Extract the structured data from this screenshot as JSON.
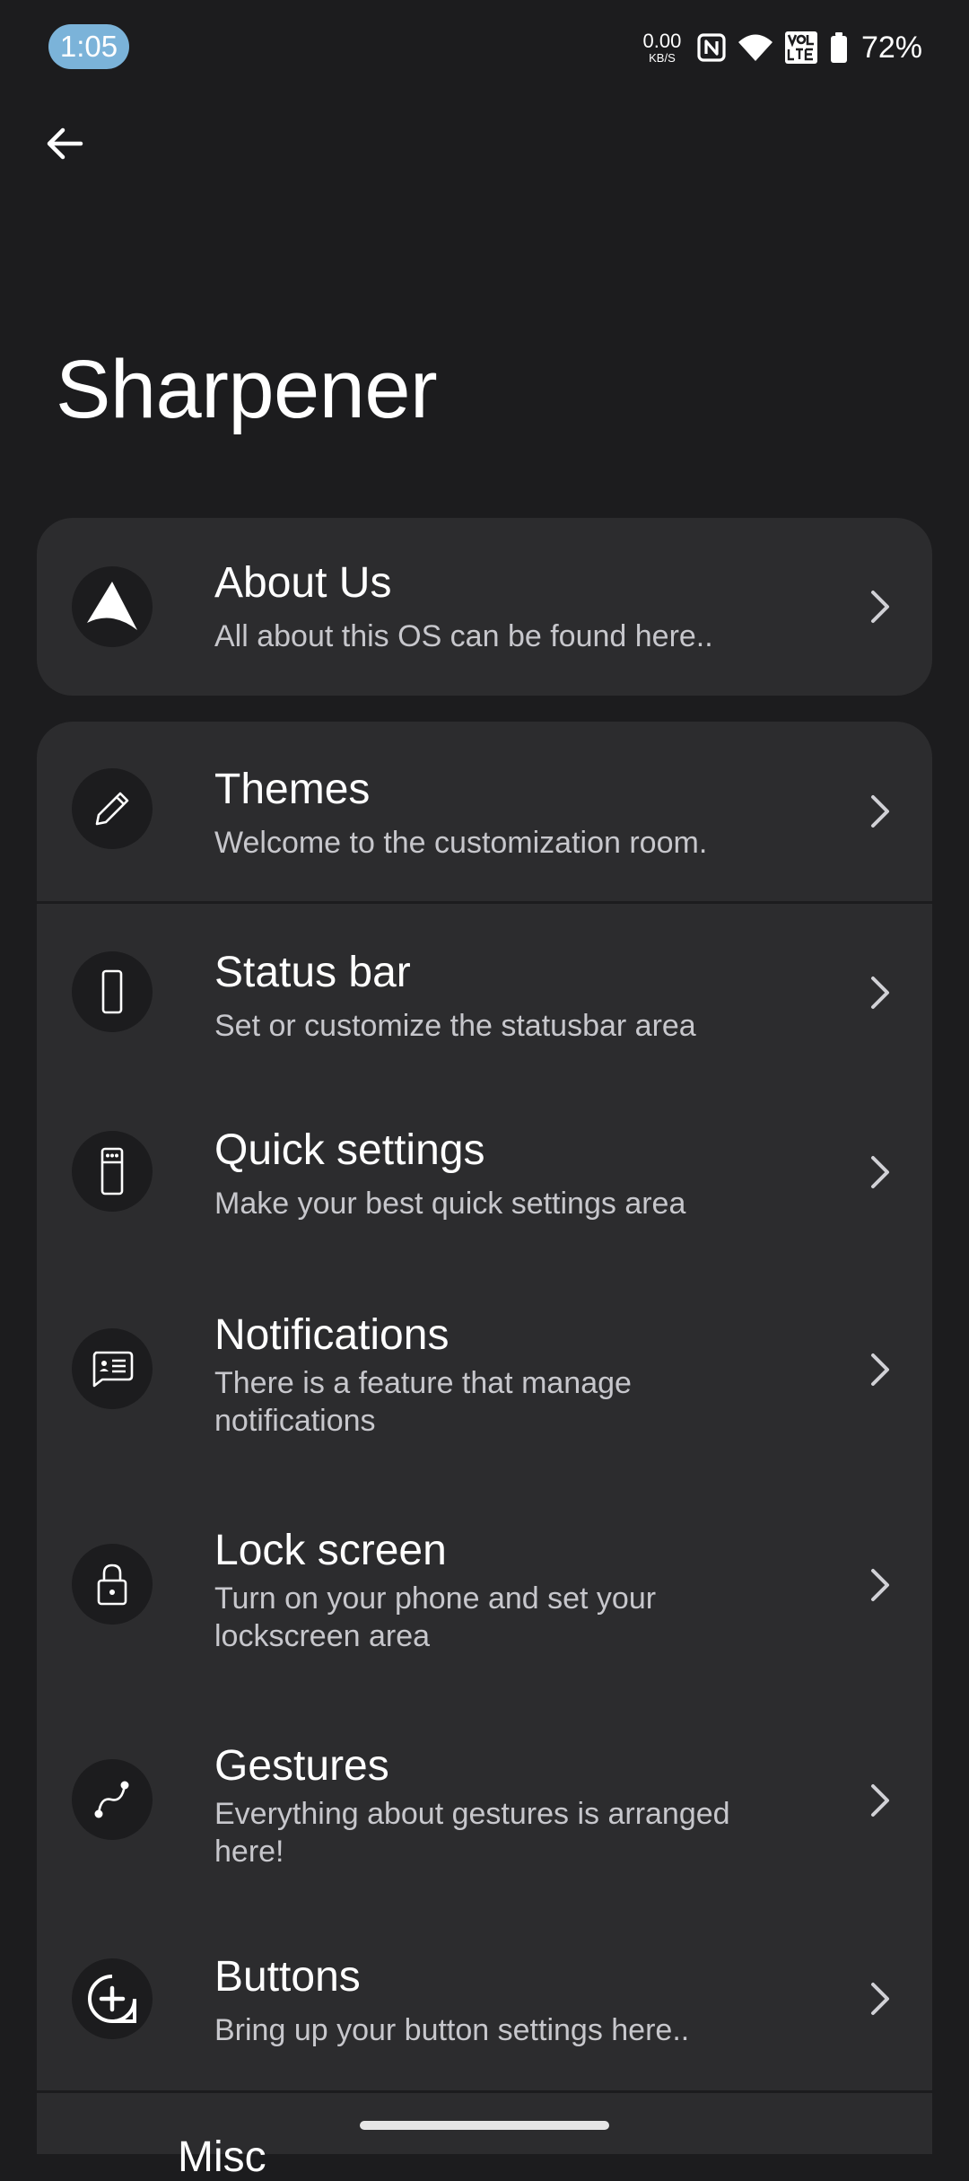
{
  "status_bar": {
    "time": "1:05",
    "net_speed_value": "0.00",
    "net_speed_unit": "KB/S",
    "battery_percent": "72%",
    "icons": [
      "nfc-icon",
      "wifi-icon",
      "volte-icon",
      "battery-icon"
    ]
  },
  "header": {
    "back_icon": "arrow-left-icon",
    "title": "Sharpener"
  },
  "items": [
    {
      "title": "About Us",
      "subtitle": "All about this OS can be found here..",
      "icon": "navigation-arrow-icon"
    },
    {
      "title": "Themes",
      "subtitle": "Welcome to the customization room.",
      "icon": "pencil-icon"
    },
    {
      "title": "Status bar",
      "subtitle": "Set or customize the statusbar area",
      "icon": "phone-outline-icon"
    },
    {
      "title": "Quick settings",
      "subtitle": "Make your best quick settings area",
      "icon": "phone-quick-settings-icon"
    },
    {
      "title": "Notifications",
      "subtitle": "There is a feature that manage notifications",
      "icon": "message-card-icon"
    },
    {
      "title": "Lock screen",
      "subtitle": "Turn on your phone and set your lockscreen area",
      "icon": "lock-icon"
    },
    {
      "title": "Gestures",
      "subtitle": "Everything about gestures is arranged here!",
      "icon": "gesture-curve-icon"
    },
    {
      "title": "Buttons",
      "subtitle": "Bring up your button settings here..",
      "icon": "plus-circle-icon"
    },
    {
      "title": "Misc"
    }
  ],
  "colors": {
    "background": "#1c1c1e",
    "card": "#2c2c2e",
    "time_pill": "#7bb3d9",
    "subtitle": "#c7c7cc"
  }
}
